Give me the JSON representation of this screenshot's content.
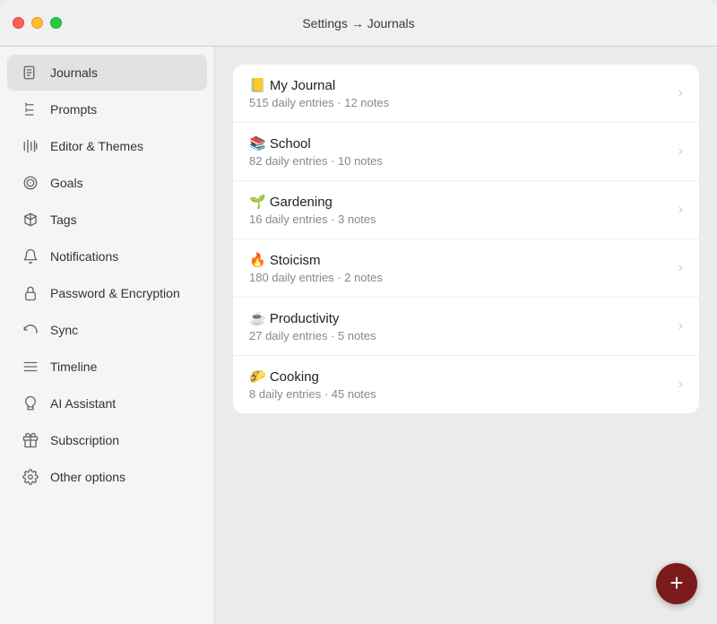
{
  "titlebar": {
    "title": "Settings → Journals"
  },
  "sidebar": {
    "items": [
      {
        "id": "journals",
        "label": "Journals",
        "icon": "journals",
        "active": true
      },
      {
        "id": "prompts",
        "label": "Prompts",
        "icon": "prompts",
        "active": false
      },
      {
        "id": "editor-themes",
        "label": "Editor & Themes",
        "icon": "editor",
        "active": false
      },
      {
        "id": "goals",
        "label": "Goals",
        "icon": "goals",
        "active": false
      },
      {
        "id": "tags",
        "label": "Tags",
        "icon": "tags",
        "active": false
      },
      {
        "id": "notifications",
        "label": "Notifications",
        "icon": "notifications",
        "active": false
      },
      {
        "id": "password-encryption",
        "label": "Password & Encryption",
        "icon": "password",
        "active": false
      },
      {
        "id": "sync",
        "label": "Sync",
        "icon": "sync",
        "active": false
      },
      {
        "id": "timeline",
        "label": "Timeline",
        "icon": "timeline",
        "active": false
      },
      {
        "id": "ai-assistant",
        "label": "AI Assistant",
        "icon": "ai",
        "active": false
      },
      {
        "id": "subscription",
        "label": "Subscription",
        "icon": "subscription",
        "active": false
      },
      {
        "id": "other-options",
        "label": "Other options",
        "icon": "other",
        "active": false
      }
    ]
  },
  "journals": {
    "items": [
      {
        "emoji": "📒",
        "name": "My Journal",
        "entries": "515 daily entries",
        "notes": "12 notes"
      },
      {
        "emoji": "📚",
        "name": "School",
        "entries": "82 daily entries",
        "notes": "10 notes"
      },
      {
        "emoji": "🌱",
        "name": "Gardening",
        "entries": "16 daily entries",
        "notes": "3 notes"
      },
      {
        "emoji": "🔥",
        "name": "Stoicism",
        "entries": "180 daily entries",
        "notes": "2 notes"
      },
      {
        "emoji": "☕",
        "name": "Productivity",
        "entries": "27 daily entries",
        "notes": "5 notes"
      },
      {
        "emoji": "🌮",
        "name": "Cooking",
        "entries": "8 daily entries",
        "notes": "45 notes"
      }
    ]
  },
  "fab": {
    "label": "+"
  }
}
